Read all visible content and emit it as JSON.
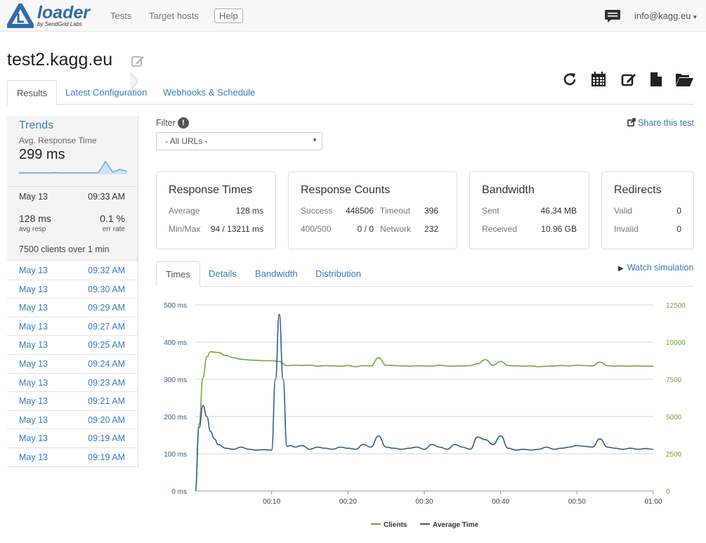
{
  "navbar": {
    "logo_word": "loader",
    "logo_sub": "by SendGrid Labs",
    "links": [
      "Tests",
      "Target hosts"
    ],
    "help": "Help",
    "user": "info@kagg.eu"
  },
  "page": {
    "title": "test2.kagg.eu",
    "tabs": [
      "Results",
      "Latest Configuration",
      "Webhooks & Schedule"
    ],
    "toolbar_icons": [
      "refresh-icon",
      "calendar-icon",
      "edit-icon",
      "file-icon",
      "folder-open-icon"
    ]
  },
  "trends": {
    "title": "Trends",
    "metric": "Avg. Response Time",
    "value": "299 ms",
    "sparkline": [
      0.1,
      0.1,
      0.1,
      0.1,
      0.1,
      0.12,
      0.1,
      0.1,
      0.1,
      0.1,
      0.1,
      0.1,
      0.9,
      0.15,
      0.35,
      0.2
    ]
  },
  "selected_run": {
    "date": "May 13",
    "time": "09:33 AM",
    "avg_resp_value": "128 ms",
    "avg_resp_label": "avg resp",
    "err_rate_value": "0.1 %",
    "err_rate_label": "err rate",
    "clients_text": "7500 clients over 1 min"
  },
  "runs": [
    {
      "date": "May 13",
      "time": "09:32 AM"
    },
    {
      "date": "May 13",
      "time": "09:30 AM"
    },
    {
      "date": "May 13",
      "time": "09:29 AM"
    },
    {
      "date": "May 13",
      "time": "09:27 AM"
    },
    {
      "date": "May 13",
      "time": "09:25 AM"
    },
    {
      "date": "May 13",
      "time": "09:24 AM"
    },
    {
      "date": "May 13",
      "time": "09:23 AM"
    },
    {
      "date": "May 13",
      "time": "09:21 AM"
    },
    {
      "date": "May 13",
      "time": "09:20 AM"
    },
    {
      "date": "May 13",
      "time": "09:19 AM"
    },
    {
      "date": "May 13",
      "time": "09:19 AM"
    }
  ],
  "filter": {
    "label": "Filter",
    "info": "!",
    "selected": "- All URLs -"
  },
  "share": "Share this test",
  "cards": {
    "response_times": {
      "title": "Response Times",
      "avg_label": "Average",
      "avg_value": "128 ms",
      "minmax_label": "Min/Max",
      "minmax_value": "94 / 13211 ms"
    },
    "response_counts": {
      "title": "Response Counts",
      "success_label": "Success",
      "success_value": "448506",
      "timeout_label": "Timeout",
      "timeout_value": "396",
      "status_label": "400/500",
      "status_value": "0 / 0",
      "network_label": "Network",
      "network_value": "232"
    },
    "bandwidth": {
      "title": "Bandwidth",
      "sent_label": "Sent",
      "sent_value": "46.34 MB",
      "received_label": "Received",
      "received_value": "10.96 GB"
    },
    "redirects": {
      "title": "Redirects",
      "valid_label": "Valid",
      "valid_value": "0",
      "invalid_label": "Invalid",
      "invalid_value": "0"
    }
  },
  "chart_tabs": [
    "Times",
    "Details",
    "Bandwidth",
    "Distribution"
  ],
  "watch_simulation": "Watch simulation",
  "colors": {
    "link": "#3a7cbf",
    "clients": "#7ba23f",
    "avg_time": "#2f5f8c"
  },
  "chart_data": {
    "type": "line",
    "x_ticks": [
      "00:10",
      "00:20",
      "00:30",
      "00:40",
      "00:50",
      "01:00"
    ],
    "x_seconds_range": [
      0,
      60
    ],
    "y_left_ticks": [
      "500 ms",
      "400 ms",
      "300 ms",
      "200 ms",
      "100 ms",
      "0 ms"
    ],
    "y_left_range": [
      0,
      500
    ],
    "y_right_ticks": [
      "12500",
      "10000",
      "7500",
      "5000",
      "2500",
      "0"
    ],
    "y_right_range": [
      0,
      12500
    ],
    "grid": true,
    "legend_position": "bottom",
    "series": [
      {
        "name": "Clients",
        "axis": "right",
        "x": [
          0,
          0.5,
          1,
          1.5,
          2,
          3,
          4,
          5,
          6,
          7,
          8,
          9,
          10,
          11,
          12,
          13,
          14,
          15,
          16,
          17,
          18,
          19,
          20,
          21,
          22,
          23,
          24,
          25,
          26,
          27,
          28,
          29,
          30,
          31,
          32,
          33,
          34,
          35,
          36,
          37,
          38,
          39,
          40,
          41,
          42,
          43,
          44,
          45,
          46,
          47,
          48,
          49,
          50,
          51,
          52,
          53,
          54,
          55,
          56,
          57,
          58,
          59,
          60
        ],
        "values": [
          0,
          4500,
          7600,
          9000,
          9350,
          9300,
          9100,
          8950,
          8850,
          8800,
          8780,
          8750,
          8750,
          8700,
          8420,
          8450,
          8430,
          8450,
          8380,
          8420,
          8400,
          8380,
          8430,
          8350,
          8420,
          8400,
          8950,
          8450,
          8430,
          8400,
          8380,
          8410,
          8400,
          8380,
          8450,
          8400,
          8380,
          8400,
          8420,
          8550,
          8820,
          8450,
          8700,
          8430,
          8400,
          8380,
          8400,
          8350,
          8380,
          8400,
          8430,
          8400,
          8450,
          8420,
          8400,
          8650,
          8420,
          8380,
          8400,
          8380,
          8400,
          8380,
          8380
        ]
      },
      {
        "name": "Average Time",
        "axis": "left",
        "x": [
          0,
          0.5,
          1,
          1.5,
          2,
          2.5,
          3,
          4,
          5,
          6,
          7,
          8,
          9,
          10,
          10.5,
          11,
          11.5,
          12,
          12.5,
          13,
          14,
          15,
          16,
          17,
          18,
          19,
          20,
          21,
          22,
          23,
          24,
          25,
          26,
          27,
          28,
          29,
          30,
          31,
          32,
          33,
          34,
          35,
          36,
          37,
          38,
          39,
          40,
          41,
          42,
          43,
          44,
          45,
          46,
          47,
          48,
          49,
          50,
          51,
          52,
          53,
          54,
          55,
          56,
          57,
          58,
          59,
          60
        ],
        "values": [
          0,
          170,
          230,
          200,
          160,
          140,
          125,
          115,
          112,
          118,
          112,
          110,
          111,
          110,
          300,
          475,
          300,
          120,
          122,
          118,
          122,
          112,
          118,
          115,
          112,
          118,
          115,
          112,
          125,
          118,
          148,
          118,
          115,
          112,
          115,
          118,
          112,
          125,
          118,
          112,
          125,
          118,
          112,
          145,
          138,
          125,
          148,
          115,
          110,
          112,
          110,
          112,
          118,
          112,
          115,
          118,
          122,
          120,
          118,
          140,
          118,
          115,
          112,
          115,
          112,
          114,
          112
        ]
      }
    ]
  }
}
